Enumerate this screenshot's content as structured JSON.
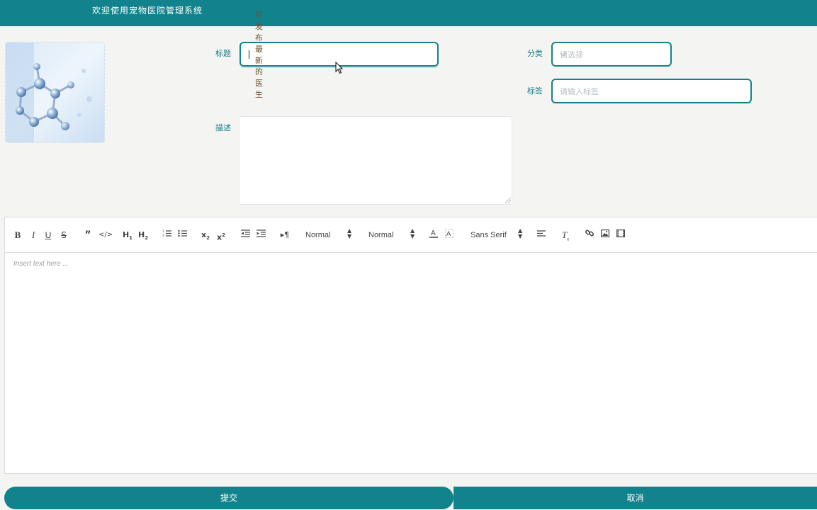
{
  "header": {
    "title": "欢迎使用宠物医院管理系统"
  },
  "form": {
    "title_label": "标题",
    "title_value": "可发布最新的医生",
    "category_label": "分类",
    "category_placeholder": "请选择",
    "tags_label": "标签",
    "tags_placeholder": "请输入标签",
    "description_label": "描述",
    "description_value": ""
  },
  "editor": {
    "header_select_1": "Normal",
    "header_select_2": "Normal",
    "font_select": "Sans Serif",
    "placeholder": "Insert text here ..."
  },
  "buttons": {
    "submit": "提交",
    "cancel": "取消"
  },
  "colors": {
    "primary": "#12838d",
    "background": "#f4f4f2"
  }
}
